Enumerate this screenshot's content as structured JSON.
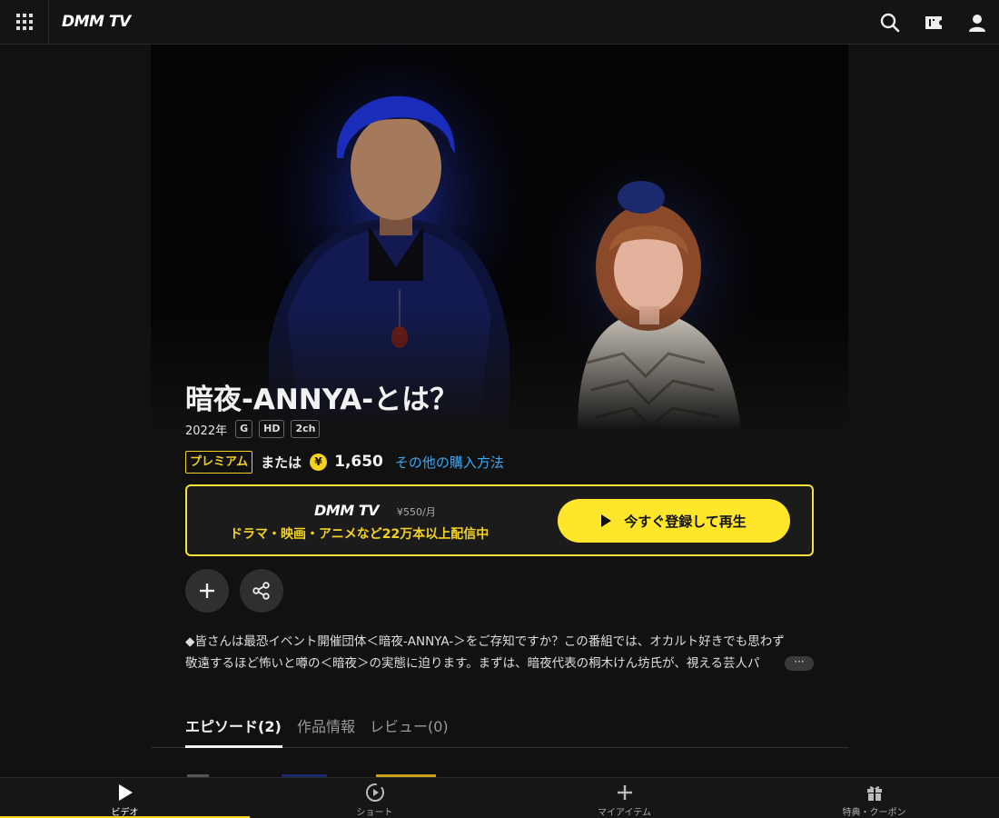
{
  "header": {
    "logo": "DMM TV"
  },
  "hero": {
    "title": "暗夜-ANNYA-とは？"
  },
  "meta": {
    "year": "2022年",
    "tags": [
      "G",
      "HD",
      "2ch"
    ]
  },
  "purchase": {
    "premium_badge": "プレミアム",
    "or_text": "または",
    "coin_symbol": "¥",
    "price": "1,650",
    "other_methods": "その他の購入方法"
  },
  "promo": {
    "logo": "DMM TV",
    "price": "¥550/月",
    "subtitle": "ドラマ・映画・アニメなど22万本以上配信中",
    "cta": "今すぐ登録して再生"
  },
  "description": {
    "line1": "◆皆さんは最恐イベント開催団体＜暗夜-ANNYA-＞をご存知ですか？この番組では、オカルト好きでも思わず",
    "line2": "敬遠するほど怖いと噂の＜暗夜＞の実態に迫ります。まずは、暗夜代表の桐木けん坊氏が、視える芸人パ",
    "more": "···"
  },
  "tabs": [
    {
      "label": "エピソード(2)"
    },
    {
      "label": "作品情報"
    },
    {
      "label": "レビュー(0)"
    }
  ],
  "bottom_nav": [
    {
      "label": "ビデオ",
      "icon": "play-icon"
    },
    {
      "label": "ショート",
      "icon": "short-play-icon"
    },
    {
      "label": "マイアイテム",
      "icon": "plus-icon"
    },
    {
      "label": "特典・クーポン",
      "icon": "gift-icon"
    }
  ],
  "colors": {
    "accent": "#ffe62b",
    "premium": "#f3cf1f",
    "link": "#3aa8f5",
    "background": "#111111"
  }
}
